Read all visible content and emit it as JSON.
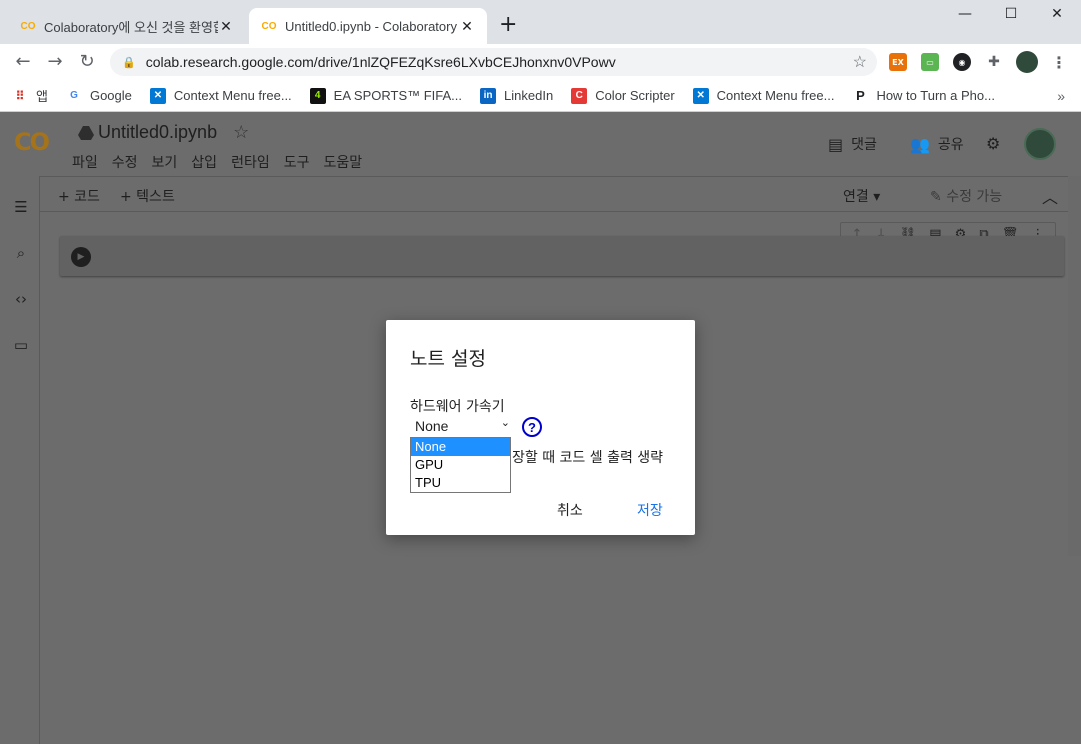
{
  "browser": {
    "tabs": [
      {
        "title": "Colaboratory에 오신 것을 환영합니다",
        "favicon": "colab-icon",
        "close": "✕"
      },
      {
        "title": "Untitled0.ipynb - Colaboratory",
        "favicon": "colab-icon",
        "close": "✕"
      }
    ],
    "new_tab": "+",
    "url": "colab.research.google.com/drive/1nlZQFEZqKsre6LXvbCEJhonxnv0VPowv",
    "bookmarks": [
      {
        "label": "앱",
        "icon": "apps-grid-icon"
      },
      {
        "label": "Google",
        "icon": "google-icon"
      },
      {
        "label": "Context Menu free...",
        "icon": "context-menu-icon"
      },
      {
        "label": "EA SPORTS™ FIFA...",
        "icon": "ea-sports-icon"
      },
      {
        "label": "LinkedIn",
        "icon": "linkedin-icon"
      },
      {
        "label": "Color Scripter",
        "icon": "color-scripter-icon"
      },
      {
        "label": "Context Menu free...",
        "icon": "context-menu-icon"
      },
      {
        "label": "How to Turn a Pho...",
        "icon": "p-icon"
      }
    ],
    "bookmarks_more": "»"
  },
  "colab": {
    "logo": "CO",
    "notebook_title": "Untitled0.ipynb",
    "menu": [
      "파일",
      "수정",
      "보기",
      "삽입",
      "런타임",
      "도구",
      "도움말"
    ],
    "comment_label": "댓글",
    "share_label": "공유",
    "add_code": "+ 코드",
    "add_text": "+ 텍스트",
    "connect_label": "연결",
    "editable_label": "수정 가능"
  },
  "dialog": {
    "title": "노트 설정",
    "accelerator_label": "하드웨어 가속기",
    "selected_value": "None",
    "options": [
      "None",
      "GPU",
      "TPU"
    ],
    "help": "?",
    "omit_output_text": "장할 때 코드 셀 출력 생략",
    "cancel_label": "취소",
    "save_label": "저장",
    "accent_color": "#1a73e8",
    "selected_option_color": "#1e90ff"
  }
}
